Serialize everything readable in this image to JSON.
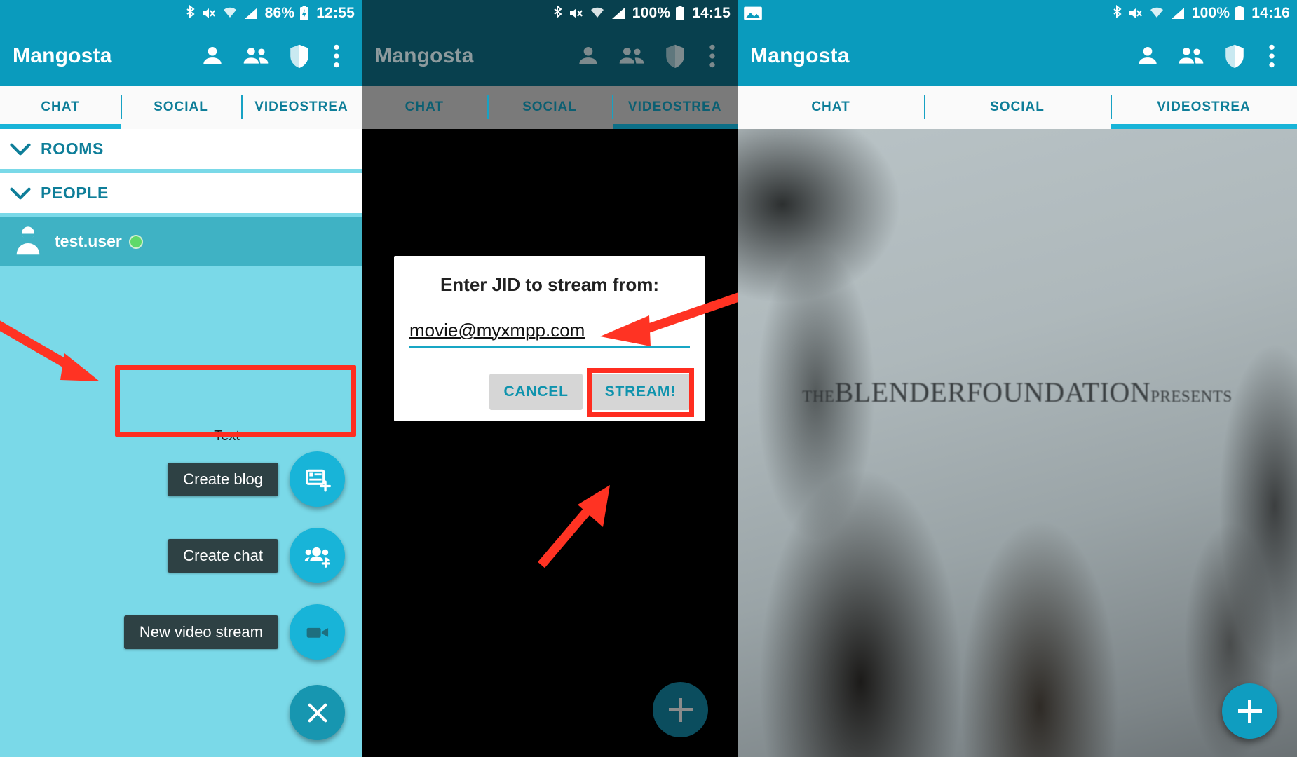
{
  "panels": [
    {
      "id": "panel-chat-fab",
      "statusbar": {
        "left_icons": [],
        "icons": [
          "bluetooth-icon",
          "mute-vibrate-icon",
          "wifi-icon",
          "cell-signal-icon"
        ],
        "battery_percent": "86%",
        "battery_icon": "battery-charging-icon",
        "time": "12:55"
      },
      "appbar": {
        "title": "Mangosta",
        "actions": [
          "person-icon",
          "people-icon",
          "shield-icon",
          "overflow-menu-icon"
        ]
      },
      "tabs": [
        {
          "label": "CHAT",
          "selected": true
        },
        {
          "label": "SOCIAL",
          "selected": false
        },
        {
          "label": "VIDEOSTREA",
          "selected": false
        }
      ],
      "sections": [
        {
          "label": "ROOMS",
          "expanded": true
        },
        {
          "label": "PEOPLE",
          "expanded": true
        }
      ],
      "contacts": [
        {
          "name": "test.user",
          "presence": "online",
          "presence_color": "#5fd96a",
          "selected": true
        }
      ],
      "fab_menu": {
        "hint": "Text",
        "items": [
          {
            "label": "Create blog",
            "icon": "new-post-icon"
          },
          {
            "label": "Create chat",
            "icon": "new-group-chat-icon"
          },
          {
            "label": "New video stream",
            "icon": "video-camera-icon",
            "highlighted": true
          }
        ],
        "close_label": "close-icon"
      }
    },
    {
      "id": "panel-stream-dialog",
      "statusbar": {
        "icons": [
          "bluetooth-icon",
          "mute-vibrate-icon",
          "wifi-icon",
          "cell-signal-icon"
        ],
        "battery_percent": "100%",
        "battery_icon": "battery-full-icon",
        "time": "14:15"
      },
      "appbar": {
        "title": "Mangosta",
        "actions": [
          "person-icon",
          "people-icon",
          "shield-icon",
          "overflow-menu-icon"
        ]
      },
      "tabs": [
        {
          "label": "CHAT",
          "selected": false
        },
        {
          "label": "SOCIAL",
          "selected": false
        },
        {
          "label": "VIDEOSTREA",
          "selected": true
        }
      ],
      "dialog": {
        "title": "Enter JID to stream from:",
        "input_value": "movie@myxmpp.com",
        "input_placeholder": "",
        "cancel_label": "CANCEL",
        "confirm_label": "STREAM!",
        "confirm_highlighted": true
      },
      "fab": {
        "icon": "plus-icon",
        "dimmed": true
      }
    },
    {
      "id": "panel-video-playing",
      "statusbar": {
        "left_icons": [
          "image-icon"
        ],
        "icons": [
          "bluetooth-icon",
          "mute-vibrate-icon",
          "wifi-icon",
          "cell-signal-icon"
        ],
        "battery_percent": "100%",
        "battery_icon": "battery-full-icon",
        "time": "14:16"
      },
      "appbar": {
        "title": "Mangosta",
        "actions": [
          "person-icon",
          "people-icon",
          "shield-icon",
          "overflow-menu-icon"
        ]
      },
      "tabs": [
        {
          "label": "CHAT",
          "selected": false
        },
        {
          "label": "SOCIAL",
          "selected": false
        },
        {
          "label": "VIDEOSTREA",
          "selected": true
        }
      ],
      "video": {
        "credit_the": "THE",
        "credit_blender": "BLENDER",
        "credit_foundation": "FOUNDATION",
        "credit_presents": "PRESENTS"
      },
      "fab": {
        "icon": "plus-icon",
        "dimmed": false
      }
    }
  ],
  "annotations": {
    "arrow_to_video_stream_label": "red-arrow",
    "arrow_to_jid_input": "red-arrow",
    "arrow_to_stream_button": "red-arrow",
    "highlight_color": "#ff2d20"
  },
  "colors": {
    "accent_teal": "#0a9bbd",
    "appbar_teal": "#0a9bbd",
    "appbar_teal_dim": "#0b4d5e",
    "content_light_blue": "#7ad9e8",
    "selected_row": "#3fb2c4",
    "tab_text": "#0e7e99",
    "tab_indicator": "#18b4d8",
    "fab_mini": "#18b4d8",
    "fab_main": "#1796b0",
    "label_dark": "#2e4144",
    "annotation_red": "#ff2d20"
  }
}
